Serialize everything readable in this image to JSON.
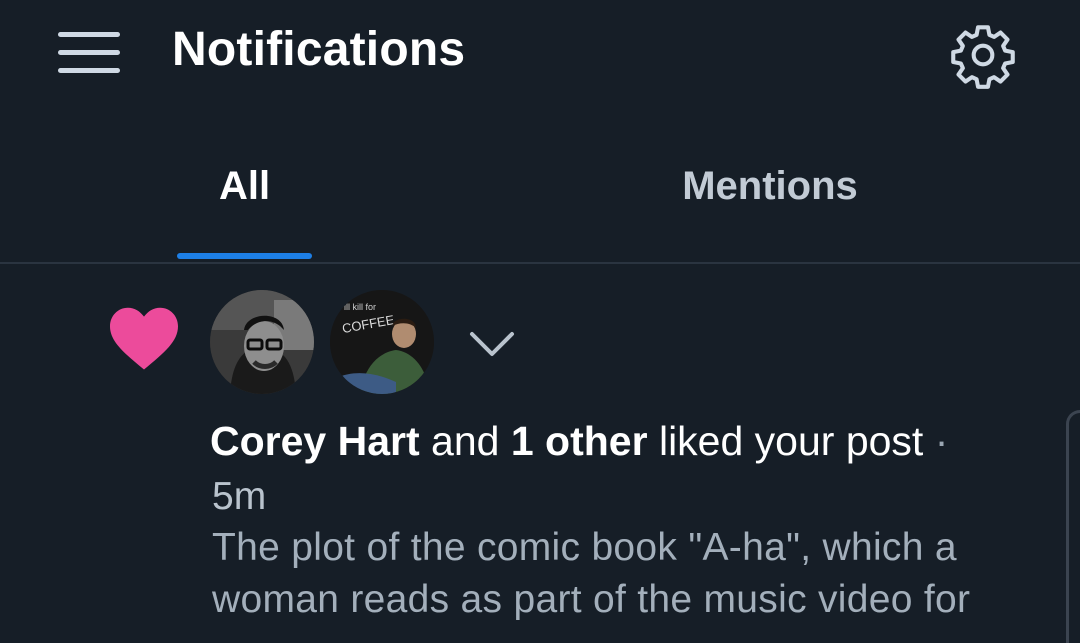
{
  "header": {
    "title": "Notifications",
    "menu_icon": "hamburger-menu-icon",
    "settings_icon": "gear-icon"
  },
  "tabs": [
    {
      "label": "All",
      "selected": true
    },
    {
      "label": "Mentions",
      "selected": false
    }
  ],
  "colors": {
    "background": "#161e27",
    "accent": "#1d7fe6",
    "like": "#ec4b9b"
  },
  "notification": {
    "type_icon": "heart-icon",
    "actor": "Corey Hart",
    "connector": "and",
    "others": "1 other",
    "action": "liked your post",
    "separator": "·",
    "time": "5m",
    "avatar_2_text_line1": "ill kill for",
    "avatar_2_text_line2": "COFFEE",
    "snippet": "The plot of the comic book \"A-ha\", which a woman reads as part of the music video for"
  }
}
